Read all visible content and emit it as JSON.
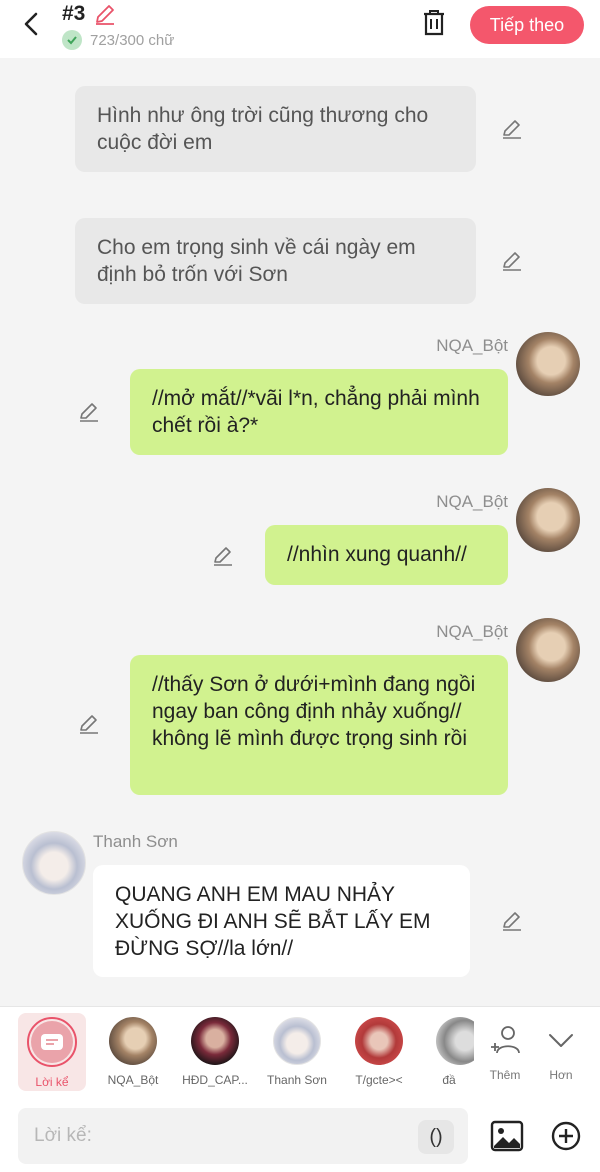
{
  "header": {
    "chapter": "#3",
    "word_count": "723/300 chữ",
    "next_label": "Tiếp theo"
  },
  "messages": [
    {
      "type": "narration",
      "text": "Hình như ông trời cũng thương cho cuộc đời em"
    },
    {
      "type": "narration",
      "text": "Cho em trọng sinh về cái ngày em định bỏ trốn với Sơn"
    },
    {
      "type": "own",
      "name": "NQA_Bột",
      "text": "//mở mắt//*vãi l*n, chẳng phải mình chết rồi à?*"
    },
    {
      "type": "own",
      "name": "NQA_Bột",
      "text": "//nhìn xung quanh//"
    },
    {
      "type": "own",
      "name": "NQA_Bột",
      "text": "//thấy Sơn ở dưới+mình đang ngồi ngay ban công định nhảy xuống// không lẽ mình được trọng sinh rồi"
    },
    {
      "type": "other",
      "name": "Thanh Sơn",
      "text": "QUANG ANH EM MAU NHẢY XUỐNG ĐI ANH SẼ BẮT LẤY EM ĐỪNG SỢ//la lớn//"
    }
  ],
  "characters": [
    {
      "label": "Lời kể",
      "selected": true
    },
    {
      "label": "NQA_Bột"
    },
    {
      "label": "HĐD_CAP..."
    },
    {
      "label": "Thanh Sơn"
    },
    {
      "label": "T/gcte><"
    },
    {
      "label": "đầ"
    }
  ],
  "actions": {
    "add_label": "Thêm",
    "more_label": "Hơn"
  },
  "input": {
    "placeholder": "Lời kể:",
    "paren": "()"
  },
  "colors": {
    "accent": "#f4576c",
    "own_bubble": "#d1f28f",
    "narration_bubble": "#e8e8e8",
    "other_bubble": "#ffffff"
  }
}
